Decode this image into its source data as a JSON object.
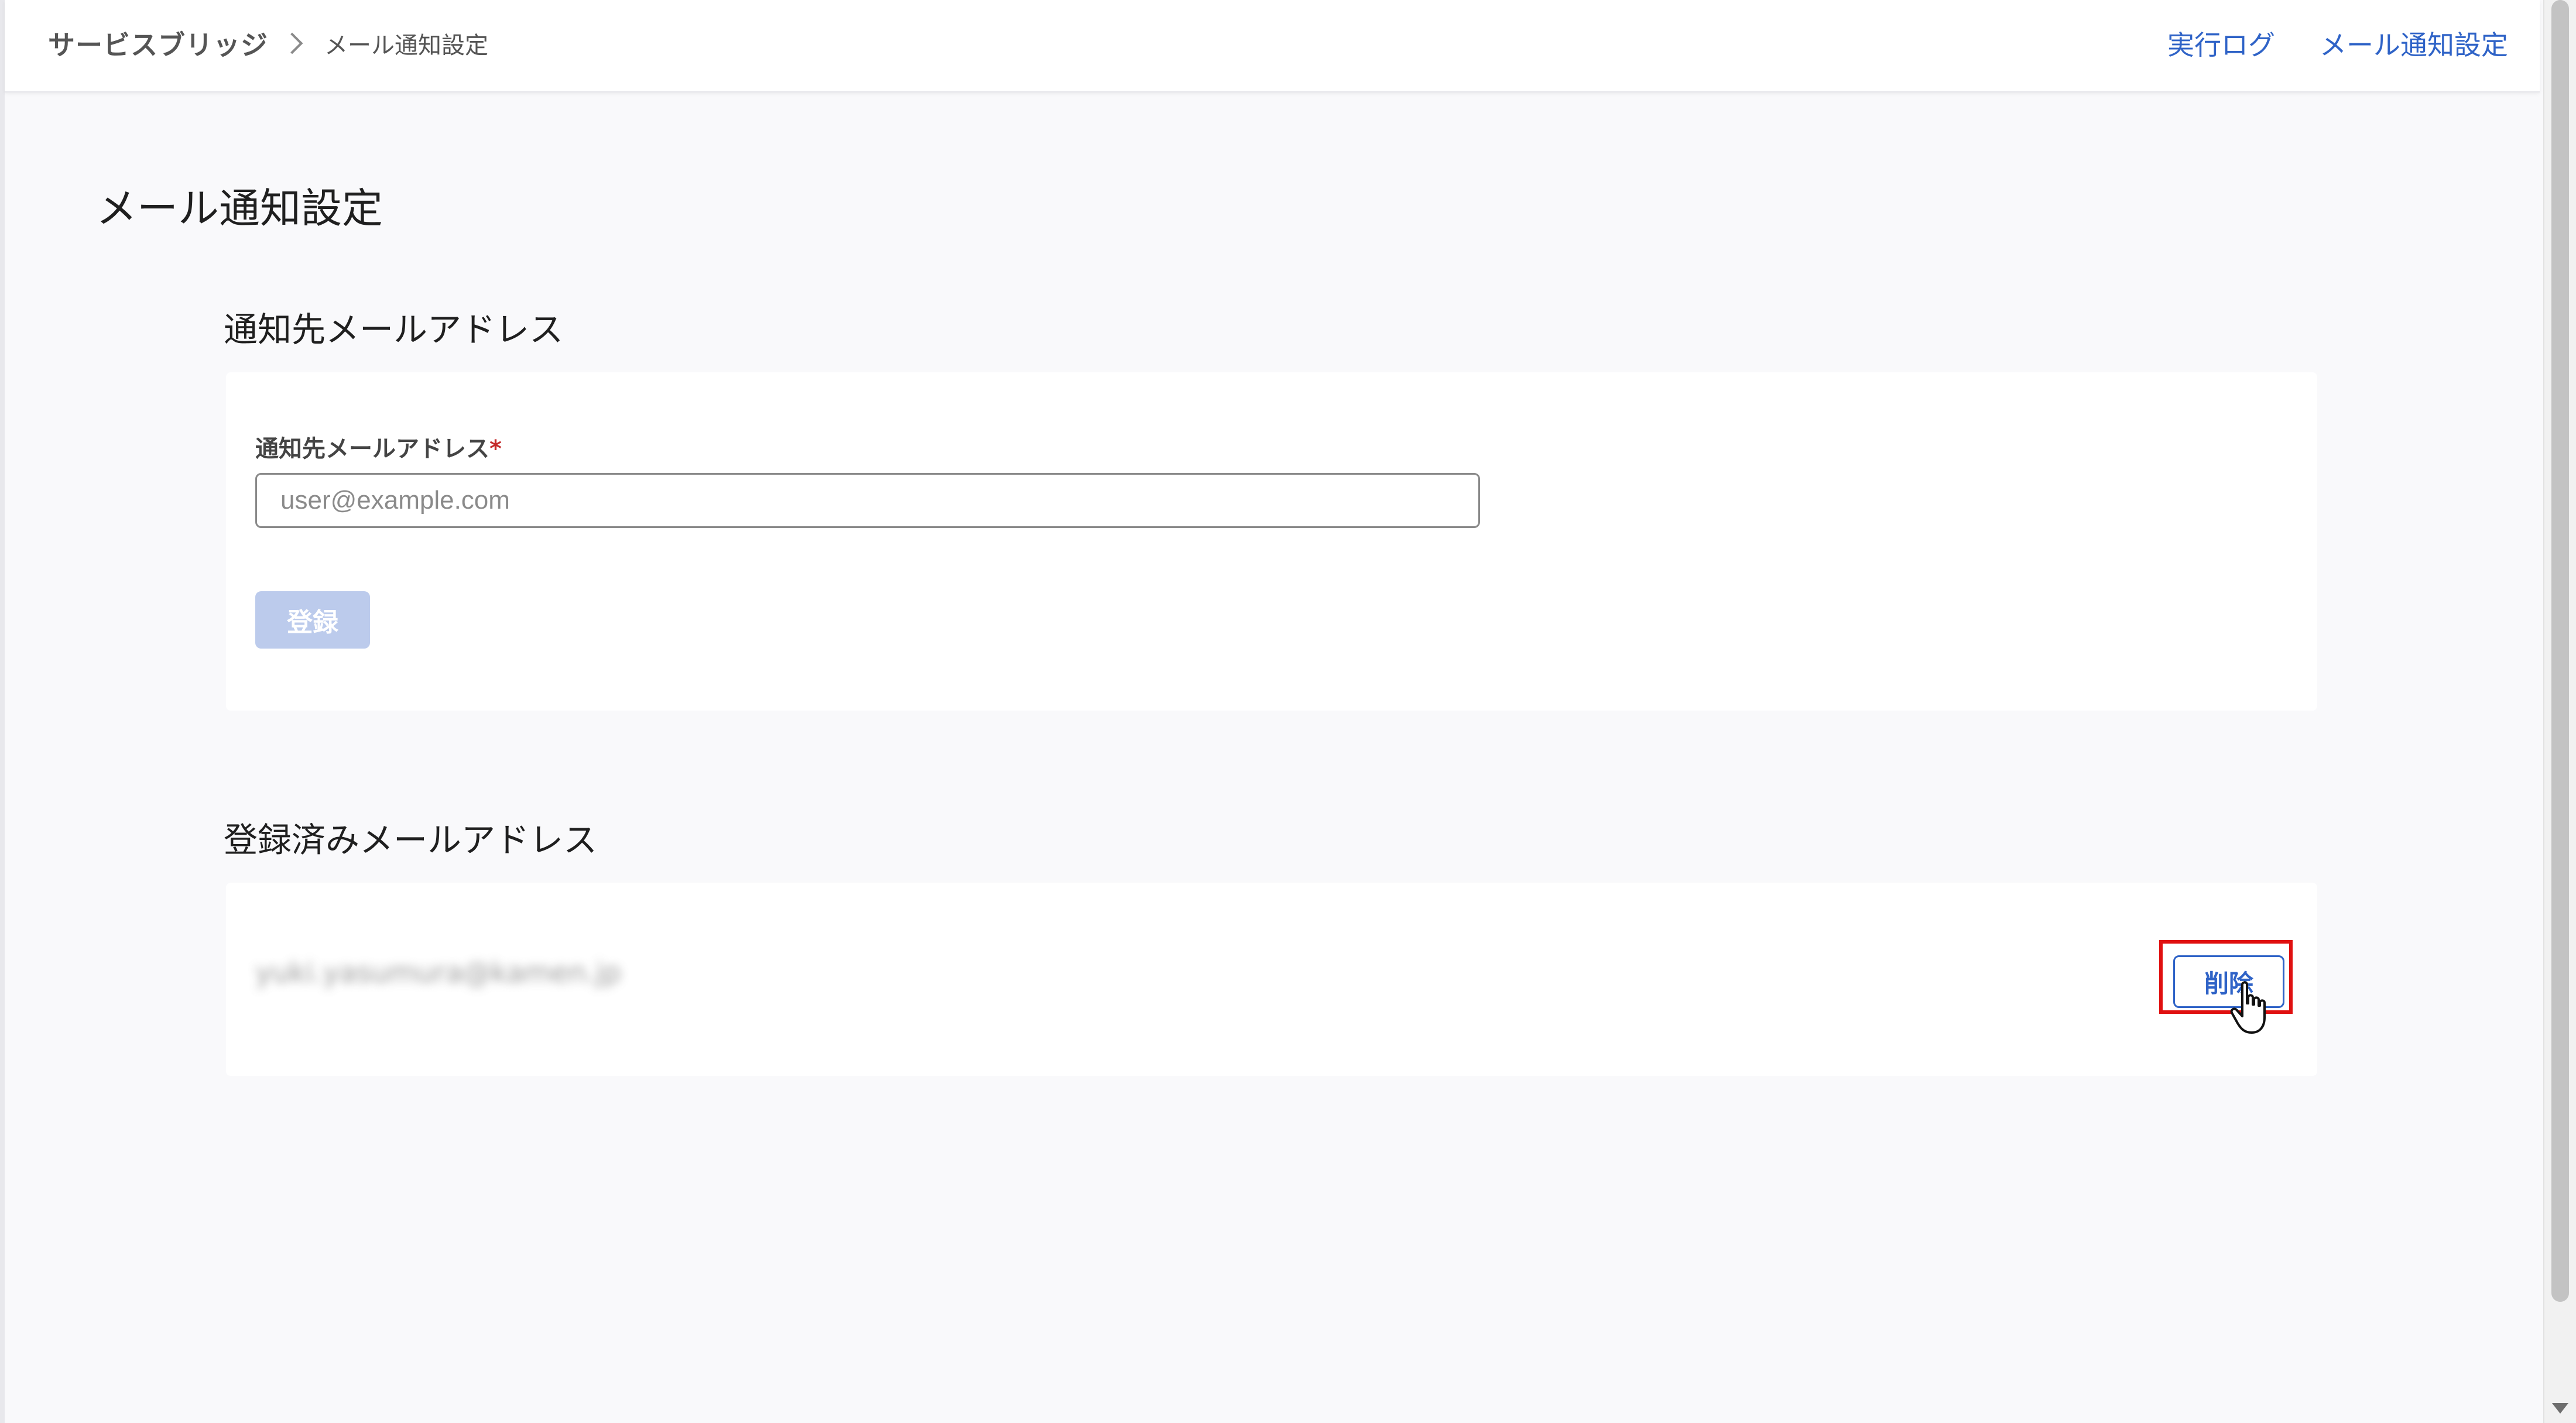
{
  "breadcrumb": {
    "root": "サービスブリッジ",
    "current": "メール通知設定"
  },
  "header_nav": {
    "execution_log": "実行ログ",
    "mail_settings": "メール通知設定"
  },
  "page": {
    "title": "メール通知設定"
  },
  "notify_section": {
    "title": "通知先メールアドレス",
    "field_label": "通知先メールアドレス",
    "required_mark": "*",
    "input_placeholder": "user@example.com",
    "input_value": "",
    "register_button": "登録"
  },
  "registered_section": {
    "title": "登録済みメールアドレス",
    "emails": [
      {
        "address": "yuki.yasumura@kamen.jp",
        "delete_button": "削除"
      }
    ]
  },
  "colors": {
    "accent": "#2f63c7",
    "disabled_button": "#bccbec",
    "highlight": "#e01010"
  }
}
